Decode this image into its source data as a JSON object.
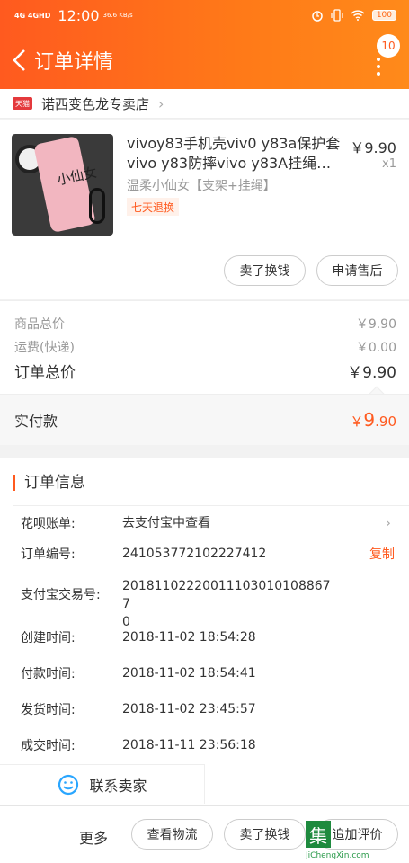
{
  "status_bar": {
    "signal": "4G 4GHD",
    "time": "12:00",
    "speed": "36.6 KB/s",
    "battery": "100"
  },
  "header": {
    "title": "订单详情",
    "badge_count": "10"
  },
  "store": {
    "platform_badge": "天猫",
    "name": "诺西变色龙专卖店"
  },
  "product": {
    "thumb_text": "小仙女",
    "title": "vivoy83手机壳viv0 y83a保护套vivo y83防摔vivo y83A挂绳…",
    "price": "￥9.90",
    "quantity": "x1",
    "sku": "温柔小仙女【支架+挂绳】",
    "tag": "七天退换",
    "buttons": [
      "卖了换钱",
      "申请售后"
    ]
  },
  "summary": {
    "goods_total_label": "商品总价",
    "goods_total_value": "￥9.90",
    "shipping_label": "运费(快递)",
    "shipping_value": "￥0.00",
    "order_total_label": "订单总价",
    "order_total_value": "￥9.90"
  },
  "paid": {
    "label": "实付款",
    "currency": "￥",
    "integer": "9",
    "decimal": ".90"
  },
  "order_info": {
    "title": "订单信息",
    "rows": [
      {
        "label": "花呗账单:",
        "value": "去支付宝中查看"
      },
      {
        "label": "订单编号:",
        "value": "241053772102227412",
        "action": "复制"
      },
      {
        "label": "支付宝交易号:",
        "value": "20181102220011103010108867​7\n0"
      },
      {
        "label": "创建时间:",
        "value": "2018-11-02 18:54:28"
      },
      {
        "label": "付款时间:",
        "value": "2018-11-02 18:54:41"
      },
      {
        "label": "发货时间:",
        "value": "2018-11-02 23:45:57"
      },
      {
        "label": "成交时间:",
        "value": "2018-11-11 23:56:18"
      }
    ],
    "contact_seller": "联系卖家"
  },
  "bottom_bar": {
    "more": "更多",
    "buttons": [
      "查看物流",
      "卖了换钱",
      "追加评价"
    ],
    "watermark_char": "集",
    "watermark_url": "JiChengXin.com"
  },
  "colors": {
    "accent": "#ff5a1f",
    "header_gradient_end": "#ff8a1a",
    "watermark_green": "#1e8a3e"
  }
}
